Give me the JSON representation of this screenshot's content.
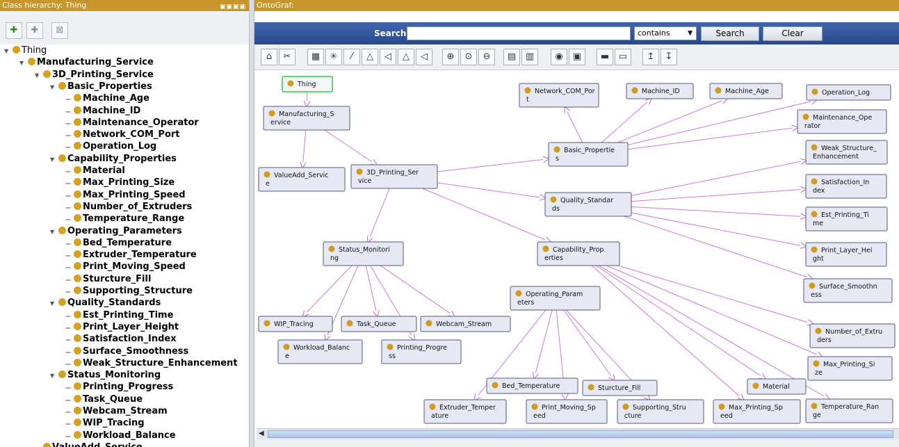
{
  "left_panel": {
    "title": "Class hierarchy: Thing",
    "window_controls": "▣▣▣▣",
    "toolbar": [
      {
        "icon": "add-subclass-icon",
        "glyph": "✚"
      },
      {
        "icon": "add-sibling-icon",
        "glyph": "✚"
      },
      {
        "icon": "delete-class-icon",
        "glyph": "⊠"
      }
    ],
    "tree": [
      {
        "label": "Thing",
        "depth": 0,
        "bold": false
      },
      {
        "label": "Manufacturing_Service",
        "depth": 1,
        "bold": true
      },
      {
        "label": "3D_Printing_Service",
        "depth": 2,
        "bold": true
      },
      {
        "label": "Basic_Properties",
        "depth": 3,
        "bold": true
      },
      {
        "label": "Machine_Age",
        "depth": 4,
        "bold": true
      },
      {
        "label": "Machine_ID",
        "depth": 4,
        "bold": true
      },
      {
        "label": "Maintenance_Operator",
        "depth": 4,
        "bold": true
      },
      {
        "label": "Network_COM_Port",
        "depth": 4,
        "bold": true
      },
      {
        "label": "Operation_Log",
        "depth": 4,
        "bold": true
      },
      {
        "label": "Capability_Properties",
        "depth": 3,
        "bold": true
      },
      {
        "label": "Material",
        "depth": 4,
        "bold": true
      },
      {
        "label": "Max_Printing_Size",
        "depth": 4,
        "bold": true
      },
      {
        "label": "Max_Printing_Speed",
        "depth": 4,
        "bold": true
      },
      {
        "label": "Number_of_Extruders",
        "depth": 4,
        "bold": true
      },
      {
        "label": "Temperature_Range",
        "depth": 4,
        "bold": true
      },
      {
        "label": "Operating_Parameters",
        "depth": 3,
        "bold": true
      },
      {
        "label": "Bed_Temperature",
        "depth": 4,
        "bold": true
      },
      {
        "label": "Extruder_Temperature",
        "depth": 4,
        "bold": true
      },
      {
        "label": "Print_Moving_Speed",
        "depth": 4,
        "bold": true
      },
      {
        "label": "Sturcture_Fill",
        "depth": 4,
        "bold": true
      },
      {
        "label": "Supporting_Structure",
        "depth": 4,
        "bold": true
      },
      {
        "label": "Quality_Standards",
        "depth": 3,
        "bold": true
      },
      {
        "label": "Est_Printing_Time",
        "depth": 4,
        "bold": true
      },
      {
        "label": "Print_Layer_Height",
        "depth": 4,
        "bold": true
      },
      {
        "label": "Satisfaction_Index",
        "depth": 4,
        "bold": true
      },
      {
        "label": "Surface_Smoothness",
        "depth": 4,
        "bold": true
      },
      {
        "label": "Weak_Structure_Enhancement",
        "depth": 4,
        "bold": true
      },
      {
        "label": "Status_Monitoring",
        "depth": 3,
        "bold": true
      },
      {
        "label": "Printing_Progress",
        "depth": 4,
        "bold": true
      },
      {
        "label": "Task_Queue",
        "depth": 4,
        "bold": true
      },
      {
        "label": "Webcam_Stream",
        "depth": 4,
        "bold": true
      },
      {
        "label": "WIP_Tracing",
        "depth": 4,
        "bold": true
      },
      {
        "label": "Workload_Balance",
        "depth": 4,
        "bold": true
      },
      {
        "label": "ValueAdd_Service",
        "depth": 2,
        "bold": true
      }
    ]
  },
  "right_panel": {
    "title": "OntoGraf:",
    "search": {
      "label": "Search:",
      "value": "",
      "match_mode": "contains",
      "search_button": "Search",
      "clear_button": "Clear"
    },
    "toolbar_icons": [
      "home-icon",
      "remove-icon",
      "grid-layout-icon",
      "radial-layout-icon",
      "spring-layout-icon",
      "tree-layout-icon",
      "horizontal-tree-icon",
      "tree-layout-2-icon",
      "horizontal-tree-2-icon",
      "zoom-in-icon",
      "zoom-reset-icon",
      "zoom-out-icon",
      "filter-nodes-icon",
      "filter-arcs-icon",
      "camera-icon",
      "export-image-icon",
      "save-icon",
      "open-icon",
      "export-icon",
      "import-icon"
    ],
    "graph": {
      "nodes": [
        {
          "id": "thing",
          "lines": [
            "Thing"
          ],
          "root": true
        },
        {
          "id": "ms",
          "lines": [
            "Manufacturing_S",
            "ervice"
          ]
        },
        {
          "id": "va",
          "lines": [
            "ValueAdd_Servic",
            "e"
          ]
        },
        {
          "id": "3d",
          "lines": [
            "3D_Printing_Ser",
            "vice"
          ]
        },
        {
          "id": "bp",
          "lines": [
            "Basic_Propertie",
            "s"
          ]
        },
        {
          "id": "ncp",
          "lines": [
            "Network_COM_Por",
            "t"
          ]
        },
        {
          "id": "mid",
          "lines": [
            "Machine_ID"
          ]
        },
        {
          "id": "mage",
          "lines": [
            "Machine_Age"
          ]
        },
        {
          "id": "olog",
          "lines": [
            "Operation_Log"
          ]
        },
        {
          "id": "mop",
          "lines": [
            "Maintenance_Ope",
            "rator"
          ]
        },
        {
          "id": "qs",
          "lines": [
            "Quality_Standar",
            "ds"
          ]
        },
        {
          "id": "wse",
          "lines": [
            "Weak_Structure_",
            "Enhancement"
          ]
        },
        {
          "id": "si",
          "lines": [
            "Satisfaction_In",
            "dex"
          ]
        },
        {
          "id": "ept",
          "lines": [
            "Est_Printing_Ti",
            "me"
          ]
        },
        {
          "id": "plh",
          "lines": [
            "Print_Layer_Hei",
            "ght"
          ]
        },
        {
          "id": "ss",
          "lines": [
            "Surface_Smoothn",
            "ess"
          ]
        },
        {
          "id": "sm",
          "lines": [
            "Status_Monitori",
            "ng"
          ]
        },
        {
          "id": "cp",
          "lines": [
            "Capability_Prop",
            "erties"
          ]
        },
        {
          "id": "op",
          "lines": [
            "Operating_Param",
            "eters"
          ]
        },
        {
          "id": "noe",
          "lines": [
            "Number_of_Extru",
            "ders"
          ]
        },
        {
          "id": "mps",
          "lines": [
            "Max_Printing_Si",
            "ze"
          ]
        },
        {
          "id": "wip",
          "lines": [
            "WIP_Tracing"
          ]
        },
        {
          "id": "tq",
          "lines": [
            "Task_Queue"
          ]
        },
        {
          "id": "ws",
          "lines": [
            "Webcam_Stream"
          ]
        },
        {
          "id": "wb",
          "lines": [
            "Workload_Balanc",
            "e"
          ]
        },
        {
          "id": "pp",
          "lines": [
            "Printing_Progre",
            "ss"
          ]
        },
        {
          "id": "bt",
          "lines": [
            "Bed_Temperature"
          ]
        },
        {
          "id": "sf",
          "lines": [
            "Sturcture_Fill"
          ]
        },
        {
          "id": "mat",
          "lines": [
            "Material"
          ]
        },
        {
          "id": "et",
          "lines": [
            "Extruder_Temper",
            "ature"
          ]
        },
        {
          "id": "pms",
          "lines": [
            "Print_Moving_Sp",
            "eed"
          ]
        },
        {
          "id": "sups",
          "lines": [
            "Supporting_Stru",
            "cture"
          ]
        },
        {
          "id": "mpsp",
          "lines": [
            "Max_Printing_Sp",
            "eed"
          ]
        },
        {
          "id": "tr",
          "lines": [
            "Temperature_Ran",
            "ge"
          ]
        }
      ],
      "edges": [
        [
          "thing",
          "ms"
        ],
        [
          "ms",
          "va"
        ],
        [
          "ms",
          "3d"
        ],
        [
          "3d",
          "bp"
        ],
        [
          "3d",
          "qs"
        ],
        [
          "3d",
          "sm"
        ],
        [
          "3d",
          "cp"
        ],
        [
          "bp",
          "ncp"
        ],
        [
          "bp",
          "mid"
        ],
        [
          "bp",
          "mage"
        ],
        [
          "bp",
          "olog"
        ],
        [
          "bp",
          "mop"
        ],
        [
          "qs",
          "wse"
        ],
        [
          "qs",
          "si"
        ],
        [
          "qs",
          "ept"
        ],
        [
          "qs",
          "plh"
        ],
        [
          "qs",
          "ss"
        ],
        [
          "sm",
          "wip"
        ],
        [
          "sm",
          "tq"
        ],
        [
          "sm",
          "ws"
        ],
        [
          "sm",
          "wb"
        ],
        [
          "sm",
          "pp"
        ],
        [
          "cp",
          "noe"
        ],
        [
          "cp",
          "mps"
        ],
        [
          "cp",
          "mat"
        ],
        [
          "cp",
          "mpsp"
        ],
        [
          "cp",
          "tr"
        ],
        [
          "op",
          "bt"
        ],
        [
          "op",
          "sf"
        ],
        [
          "op",
          "et"
        ],
        [
          "op",
          "pms"
        ],
        [
          "op",
          "sups"
        ]
      ]
    }
  }
}
